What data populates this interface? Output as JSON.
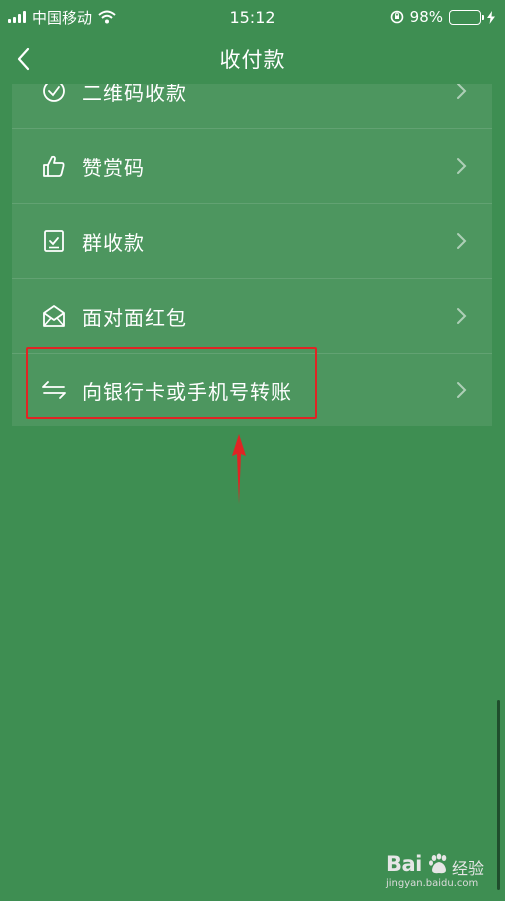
{
  "status_bar": {
    "carrier": "中国移动",
    "time": "15:12",
    "battery_percent": "98%",
    "battery_level": 0.98
  },
  "nav": {
    "title": "收付款"
  },
  "menu_items": [
    {
      "label": "二维码收款",
      "icon": "qr-check-icon"
    },
    {
      "label": "赞赏码",
      "icon": "thumbs-up-icon"
    },
    {
      "label": "群收款",
      "icon": "group-bill-icon"
    },
    {
      "label": "面对面红包",
      "icon": "red-envelope-icon"
    },
    {
      "label": "向银行卡或手机号转账",
      "icon": "transfer-arrows-icon"
    }
  ],
  "watermark": {
    "brand": "Bai",
    "brand_cn": "经验",
    "url": "jingyan.baidu.com"
  },
  "colors": {
    "background": "#3e8e52",
    "highlight": "#e02424",
    "battery_fill": "#4cd964"
  }
}
